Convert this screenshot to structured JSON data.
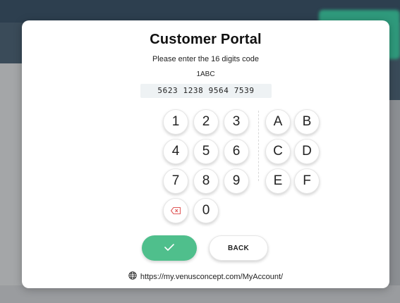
{
  "title": "Customer Portal",
  "subtitle": "Please enter the 16 digits code",
  "code_prefix": "1ABC",
  "code_value": "5623 1238 9564 7539",
  "numeric_keys": [
    "1",
    "2",
    "3",
    "4",
    "5",
    "6",
    "7",
    "8",
    "9"
  ],
  "letter_keys": [
    "A",
    "B",
    "C",
    "D",
    "E",
    "F"
  ],
  "zero_key": "0",
  "back_label": "BACK",
  "url": "https://my.venusconcept.com/MyAccount/",
  "colors": {
    "confirm": "#4fbf8c",
    "delete": "#e05a5a",
    "code_bg": "#eef2f4"
  },
  "icons": {
    "confirm": "check-icon",
    "delete": "backspace-icon",
    "url": "globe-icon"
  }
}
